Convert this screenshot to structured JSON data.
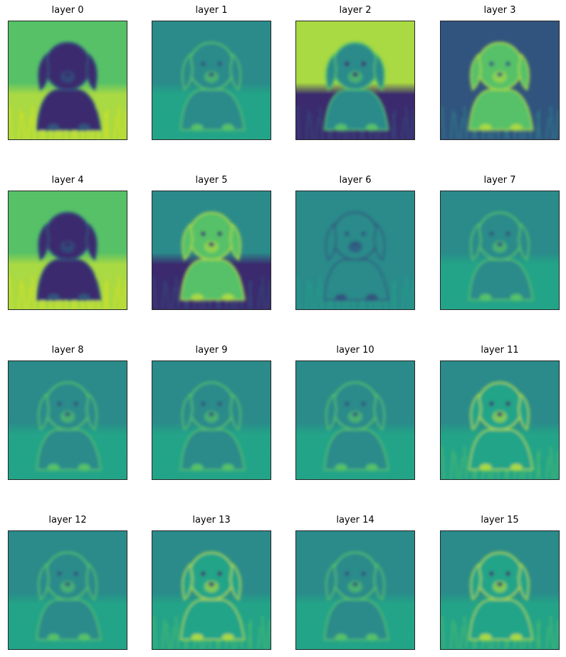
{
  "figure": {
    "colormap": "viridis",
    "subject": "puppy sitting in grass",
    "panels": [
      {
        "title": "layer 0",
        "style": "bright-bg-dark-dog"
      },
      {
        "title": "layer 1",
        "style": "edge-flat"
      },
      {
        "title": "layer 2",
        "style": "bright-top-dark-bottom"
      },
      {
        "title": "layer 3",
        "style": "dark-bg-bright-dog"
      },
      {
        "title": "layer 4",
        "style": "bright-bg-dark-dog"
      },
      {
        "title": "layer 5",
        "style": "mid-top-dark-bottom"
      },
      {
        "title": "layer 6",
        "style": "edge-faint"
      },
      {
        "title": "layer 7",
        "style": "edge-flat"
      },
      {
        "title": "layer 8",
        "style": "edge-flat"
      },
      {
        "title": "layer 9",
        "style": "edge-flat"
      },
      {
        "title": "layer 10",
        "style": "edge-flat"
      },
      {
        "title": "layer 11",
        "style": "edge-bright"
      },
      {
        "title": "layer 12",
        "style": "edge-flat"
      },
      {
        "title": "layer 13",
        "style": "edge-bright"
      },
      {
        "title": "layer 14",
        "style": "edge-flat"
      },
      {
        "title": "layer 15",
        "style": "edge-bright"
      }
    ],
    "palette": {
      "deep": "#3b2a6e",
      "dark": "#31547f",
      "mid": "#2a8b8a",
      "teal": "#23a488",
      "green": "#57c167",
      "lime": "#a9d943",
      "yellow": "#e3e418"
    }
  }
}
